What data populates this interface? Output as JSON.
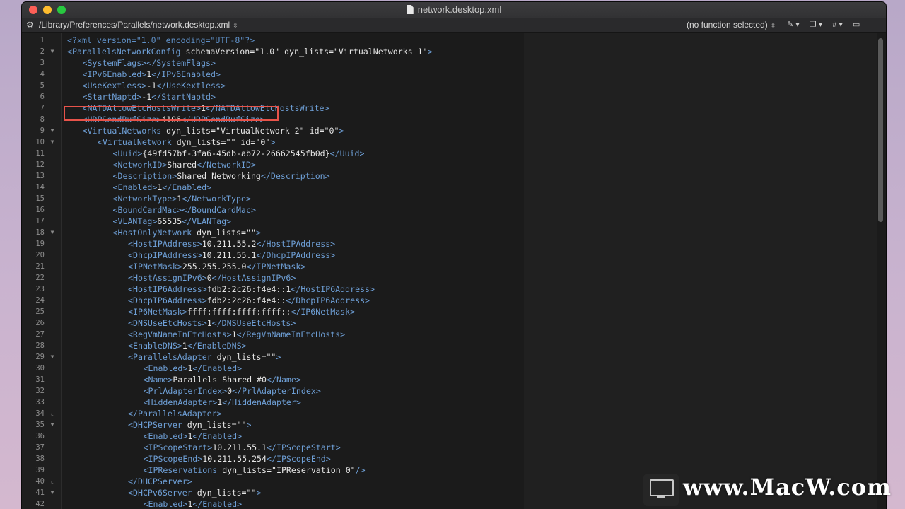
{
  "window": {
    "title": "network.desktop.xml"
  },
  "navbar": {
    "path": "/Library/Preferences/Parallels/network.desktop.xml",
    "function_menu": "(no function selected)",
    "tool_icons": [
      "pencil-icon",
      "docs-icon",
      "hash-icon",
      "clipboard-icon"
    ]
  },
  "editor": {
    "lines": [
      {
        "n": "1",
        "fold": "",
        "indent": 0,
        "parts": [
          [
            "pi",
            "<?xml version=\"1.0\" encoding=\"UTF-8\"?>"
          ]
        ]
      },
      {
        "n": "2",
        "fold": "▼",
        "indent": 0,
        "parts": [
          [
            "tag",
            "<ParallelsNetworkConfig "
          ],
          [
            "txt",
            "schemaVersion=\"1.0\" dyn_lists=\"VirtualNetworks 1\""
          ],
          [
            "tag",
            ">"
          ]
        ]
      },
      {
        "n": "3",
        "fold": "",
        "indent": 1,
        "parts": [
          [
            "tag",
            "<SystemFlags></SystemFlags>"
          ]
        ]
      },
      {
        "n": "4",
        "fold": "",
        "indent": 1,
        "parts": [
          [
            "tag",
            "<IPv6Enabled>"
          ],
          [
            "txt",
            "1"
          ],
          [
            "tag",
            "</IPv6Enabled>"
          ]
        ]
      },
      {
        "n": "5",
        "fold": "",
        "indent": 1,
        "parts": [
          [
            "tag",
            "<UseKextless>"
          ],
          [
            "txt",
            "-1"
          ],
          [
            "tag",
            "</UseKextless>"
          ]
        ]
      },
      {
        "n": "6",
        "fold": "",
        "indent": 1,
        "parts": [
          [
            "tag",
            "<StartNaptd>"
          ],
          [
            "txt",
            "-1"
          ],
          [
            "tag",
            "</StartNaptd>"
          ]
        ]
      },
      {
        "n": "7",
        "fold": "",
        "indent": 1,
        "parts": [
          [
            "tag",
            "<NATDAllowEtcHostsWrite>"
          ],
          [
            "txt",
            "1"
          ],
          [
            "tag",
            "</NATDAllowEtcHostsWrite>"
          ]
        ]
      },
      {
        "n": "8",
        "fold": "",
        "indent": 1,
        "parts": [
          [
            "tag",
            "<UDPSendBufSize>"
          ],
          [
            "txt",
            "4106"
          ],
          [
            "tag",
            "</UDPSendBufSize>"
          ]
        ]
      },
      {
        "n": "9",
        "fold": "▼",
        "indent": 1,
        "parts": [
          [
            "tag",
            "<VirtualNetworks "
          ],
          [
            "txt",
            "dyn_lists=\"VirtualNetwork 2\" id=\"0\""
          ],
          [
            "tag",
            ">"
          ]
        ]
      },
      {
        "n": "10",
        "fold": "▼",
        "indent": 2,
        "parts": [
          [
            "tag",
            "<VirtualNetwork "
          ],
          [
            "txt",
            "dyn_lists=\"\" id=\"0\""
          ],
          [
            "tag",
            ">"
          ]
        ]
      },
      {
        "n": "11",
        "fold": "",
        "indent": 3,
        "parts": [
          [
            "tag",
            "<Uuid>"
          ],
          [
            "txt",
            "{49fd57bf-3fa6-45db-ab72-26662545fb0d}"
          ],
          [
            "tag",
            "</Uuid>"
          ]
        ]
      },
      {
        "n": "12",
        "fold": "",
        "indent": 3,
        "parts": [
          [
            "tag",
            "<NetworkID>"
          ],
          [
            "txt",
            "Shared"
          ],
          [
            "tag",
            "</NetworkID>"
          ]
        ]
      },
      {
        "n": "13",
        "fold": "",
        "indent": 3,
        "parts": [
          [
            "tag",
            "<Description>"
          ],
          [
            "txt",
            "Shared Networking"
          ],
          [
            "tag",
            "</Description>"
          ]
        ]
      },
      {
        "n": "14",
        "fold": "",
        "indent": 3,
        "parts": [
          [
            "tag",
            "<Enabled>"
          ],
          [
            "txt",
            "1"
          ],
          [
            "tag",
            "</Enabled>"
          ]
        ]
      },
      {
        "n": "15",
        "fold": "",
        "indent": 3,
        "parts": [
          [
            "tag",
            "<NetworkType>"
          ],
          [
            "txt",
            "1"
          ],
          [
            "tag",
            "</NetworkType>"
          ]
        ]
      },
      {
        "n": "16",
        "fold": "",
        "indent": 3,
        "parts": [
          [
            "tag",
            "<BoundCardMac></BoundCardMac>"
          ]
        ]
      },
      {
        "n": "17",
        "fold": "",
        "indent": 3,
        "parts": [
          [
            "tag",
            "<VLANTag>"
          ],
          [
            "txt",
            "65535"
          ],
          [
            "tag",
            "</VLANTag>"
          ]
        ]
      },
      {
        "n": "18",
        "fold": "▼",
        "indent": 3,
        "parts": [
          [
            "tag",
            "<HostOnlyNetwork "
          ],
          [
            "txt",
            "dyn_lists=\"\""
          ],
          [
            "tag",
            ">"
          ]
        ]
      },
      {
        "n": "19",
        "fold": "",
        "indent": 4,
        "parts": [
          [
            "tag",
            "<HostIPAddress>"
          ],
          [
            "txt",
            "10.211.55.2"
          ],
          [
            "tag",
            "</HostIPAddress>"
          ]
        ]
      },
      {
        "n": "20",
        "fold": "",
        "indent": 4,
        "parts": [
          [
            "tag",
            "<DhcpIPAddress>"
          ],
          [
            "txt",
            "10.211.55.1"
          ],
          [
            "tag",
            "</DhcpIPAddress>"
          ]
        ]
      },
      {
        "n": "21",
        "fold": "",
        "indent": 4,
        "parts": [
          [
            "tag",
            "<IPNetMask>"
          ],
          [
            "txt",
            "255.255.255.0"
          ],
          [
            "tag",
            "</IPNetMask>"
          ]
        ]
      },
      {
        "n": "22",
        "fold": "",
        "indent": 4,
        "parts": [
          [
            "tag",
            "<HostAssignIPv6>"
          ],
          [
            "txt",
            "0"
          ],
          [
            "tag",
            "</HostAssignIPv6>"
          ]
        ]
      },
      {
        "n": "23",
        "fold": "",
        "indent": 4,
        "parts": [
          [
            "tag",
            "<HostIP6Address>"
          ],
          [
            "txt",
            "fdb2:2c26:f4e4::1"
          ],
          [
            "tag",
            "</HostIP6Address>"
          ]
        ]
      },
      {
        "n": "24",
        "fold": "",
        "indent": 4,
        "parts": [
          [
            "tag",
            "<DhcpIP6Address>"
          ],
          [
            "txt",
            "fdb2:2c26:f4e4::"
          ],
          [
            "tag",
            "</DhcpIP6Address>"
          ]
        ]
      },
      {
        "n": "25",
        "fold": "",
        "indent": 4,
        "parts": [
          [
            "tag",
            "<IP6NetMask>"
          ],
          [
            "txt",
            "ffff:ffff:ffff:ffff::"
          ],
          [
            "tag",
            "</IP6NetMask>"
          ]
        ]
      },
      {
        "n": "26",
        "fold": "",
        "indent": 4,
        "parts": [
          [
            "tag",
            "<DNSUseEtcHosts>"
          ],
          [
            "txt",
            "1"
          ],
          [
            "tag",
            "</DNSUseEtcHosts>"
          ]
        ]
      },
      {
        "n": "27",
        "fold": "",
        "indent": 4,
        "parts": [
          [
            "tag",
            "<RegVmNameInEtcHosts>"
          ],
          [
            "txt",
            "1"
          ],
          [
            "tag",
            "</RegVmNameInEtcHosts>"
          ]
        ]
      },
      {
        "n": "28",
        "fold": "",
        "indent": 4,
        "parts": [
          [
            "tag",
            "<EnableDNS>"
          ],
          [
            "txt",
            "1"
          ],
          [
            "tag",
            "</EnableDNS>"
          ]
        ]
      },
      {
        "n": "29",
        "fold": "▼",
        "indent": 4,
        "parts": [
          [
            "tag",
            "<ParallelsAdapter "
          ],
          [
            "txt",
            "dyn_lists=\"\""
          ],
          [
            "tag",
            ">"
          ]
        ]
      },
      {
        "n": "30",
        "fold": "",
        "indent": 5,
        "parts": [
          [
            "tag",
            "<Enabled>"
          ],
          [
            "txt",
            "1"
          ],
          [
            "tag",
            "</Enabled>"
          ]
        ]
      },
      {
        "n": "31",
        "fold": "",
        "indent": 5,
        "parts": [
          [
            "tag",
            "<Name>"
          ],
          [
            "txt",
            "Parallels Shared #0"
          ],
          [
            "tag",
            "</Name>"
          ]
        ]
      },
      {
        "n": "32",
        "fold": "",
        "indent": 5,
        "parts": [
          [
            "tag",
            "<PrlAdapterIndex>"
          ],
          [
            "txt",
            "0"
          ],
          [
            "tag",
            "</PrlAdapterIndex>"
          ]
        ]
      },
      {
        "n": "33",
        "fold": "",
        "indent": 5,
        "parts": [
          [
            "tag",
            "<HiddenAdapter>"
          ],
          [
            "txt",
            "1"
          ],
          [
            "tag",
            "</HiddenAdapter>"
          ]
        ]
      },
      {
        "n": "34",
        "fold": "⌞",
        "indent": 4,
        "parts": [
          [
            "tag",
            "</ParallelsAdapter>"
          ]
        ]
      },
      {
        "n": "35",
        "fold": "▼",
        "indent": 4,
        "parts": [
          [
            "tag",
            "<DHCPServer "
          ],
          [
            "txt",
            "dyn_lists=\"\""
          ],
          [
            "tag",
            ">"
          ]
        ]
      },
      {
        "n": "36",
        "fold": "",
        "indent": 5,
        "parts": [
          [
            "tag",
            "<Enabled>"
          ],
          [
            "txt",
            "1"
          ],
          [
            "tag",
            "</Enabled>"
          ]
        ]
      },
      {
        "n": "37",
        "fold": "",
        "indent": 5,
        "parts": [
          [
            "tag",
            "<IPScopeStart>"
          ],
          [
            "txt",
            "10.211.55.1"
          ],
          [
            "tag",
            "</IPScopeStart>"
          ]
        ]
      },
      {
        "n": "38",
        "fold": "",
        "indent": 5,
        "parts": [
          [
            "tag",
            "<IPScopeEnd>"
          ],
          [
            "txt",
            "10.211.55.254"
          ],
          [
            "tag",
            "</IPScopeEnd>"
          ]
        ]
      },
      {
        "n": "39",
        "fold": "",
        "indent": 5,
        "parts": [
          [
            "tag",
            "<IPReservations "
          ],
          [
            "txt",
            "dyn_lists=\"IPReservation 0\""
          ],
          [
            "tag",
            "/>"
          ]
        ]
      },
      {
        "n": "40",
        "fold": "⌞",
        "indent": 4,
        "parts": [
          [
            "tag",
            "</DHCPServer>"
          ]
        ]
      },
      {
        "n": "41",
        "fold": "▼",
        "indent": 4,
        "parts": [
          [
            "tag",
            "<DHCPv6Server "
          ],
          [
            "txt",
            "dyn_lists=\"\""
          ],
          [
            "tag",
            ">"
          ]
        ]
      },
      {
        "n": "42",
        "fold": "",
        "indent": 5,
        "parts": [
          [
            "tag",
            "<Enabled>"
          ],
          [
            "txt",
            "1"
          ],
          [
            "tag",
            "</Enabled>"
          ]
        ]
      }
    ]
  },
  "watermark": {
    "text": "www.MacW.com"
  },
  "colors": {
    "tag": "#6e9fd6",
    "text": "#e6e6e6",
    "highlight": "#e8534a",
    "background": "#1b1b1b"
  }
}
